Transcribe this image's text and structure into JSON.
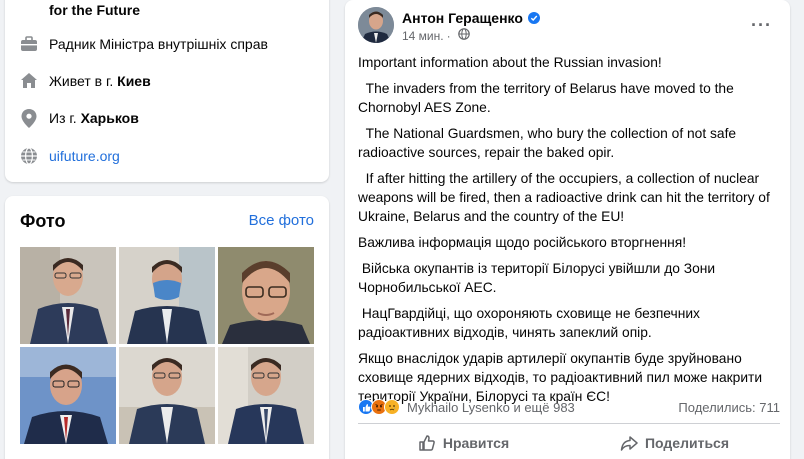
{
  "intro": {
    "org_line": "for the Future",
    "job": "Радник Міністра внутрішніх справ",
    "lives_prefix": "Живет в г. ",
    "lives_city": "Киев",
    "from_prefix": "Из г. ",
    "from_city": "Харьков",
    "website": "uifuture.org"
  },
  "photos": {
    "title": "Фото",
    "see_all": "Все фото"
  },
  "post": {
    "author": "Антон Геращенко",
    "time": "14 мин.",
    "paragraphs": [
      "Important information about the Russian invasion!",
      "  The invaders from the territory of Belarus have moved to the Chornobyl AES Zone.",
      "  The National Guardsmen, who bury the collection of not safe radioactive sources, repair the baked opir.",
      "  If after hitting the artillery of the occupiers, a collection of nuclear weapons will be fired, then a radioactive drink can hit the territory of Ukraine, Belarus and the country of the EU!",
      "Важлива інформація щодо російського вторгнення!",
      " Війська окупантів із території Білорусі увійшли до Зони Чорнобильської АЕС.",
      " НацГвардійці, що охороняють сховище не безпечних радіоактивних відходів, чинять запеклий опір.",
      "Якщо внаслідок ударів артилерії окупантів буде зруйновано сховище ядерних відходів, то радіоактивний пил може накрити території України, Білорусі та країн ЄС!"
    ],
    "reactions_text": "Mykhailo Lysenko и ещё 983",
    "shares_text": "Поделились: 711",
    "like_label": "Нравится",
    "share_label": "Поделиться"
  },
  "colors": {
    "link": "#216fdb",
    "like_blue": "#1877f2",
    "angry": "#e9710f",
    "sad": "#f7b125"
  },
  "icons": [
    "briefcase-icon",
    "home-icon",
    "location-icon",
    "globe-icon",
    "verified-icon",
    "more-icon",
    "like-icon",
    "share-icon"
  ]
}
